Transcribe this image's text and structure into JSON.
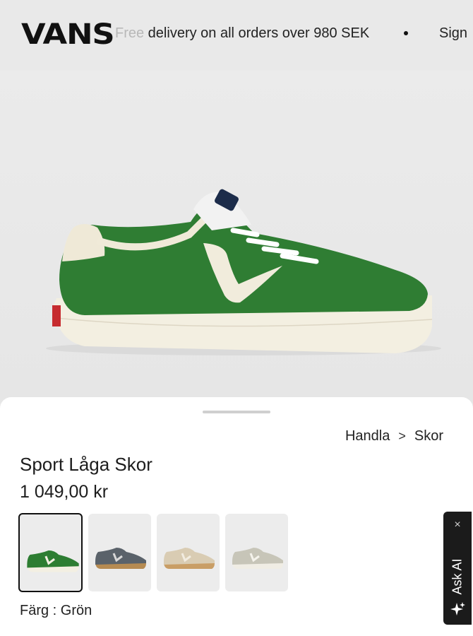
{
  "header": {
    "logo": "VANS",
    "promo_faded": "Free",
    "promo_rest": " delivery on all orders over 980 SEK",
    "signin": "Sign"
  },
  "product": {
    "breadcrumb": [
      "Handla",
      "Skor"
    ],
    "breadcrumb_separator": ">",
    "title": "Sport Låga Skor",
    "price": "1 049,00 kr",
    "color_label": "Färg : Grön",
    "swatches": [
      {
        "name": "Grön",
        "upper": "#2d7d32",
        "sole": "#f3efe2",
        "selected": true
      },
      {
        "name": "Grå",
        "upper": "#5a626a",
        "sole": "#b68b52",
        "selected": false
      },
      {
        "name": "Beige",
        "upper": "#d9ccb3",
        "sole": "#c99e66",
        "selected": false
      },
      {
        "name": "Ljusgrå",
        "upper": "#c7c5b8",
        "sole": "#f0ede4",
        "selected": false
      }
    ]
  },
  "ask_ai": {
    "close": "×",
    "label": "Ask AI"
  },
  "colors": {
    "shoe_green": "#2f7f34",
    "sole_cream": "#f2eee0",
    "heel_red": "#c8282e",
    "background": "#e9e9e9"
  }
}
